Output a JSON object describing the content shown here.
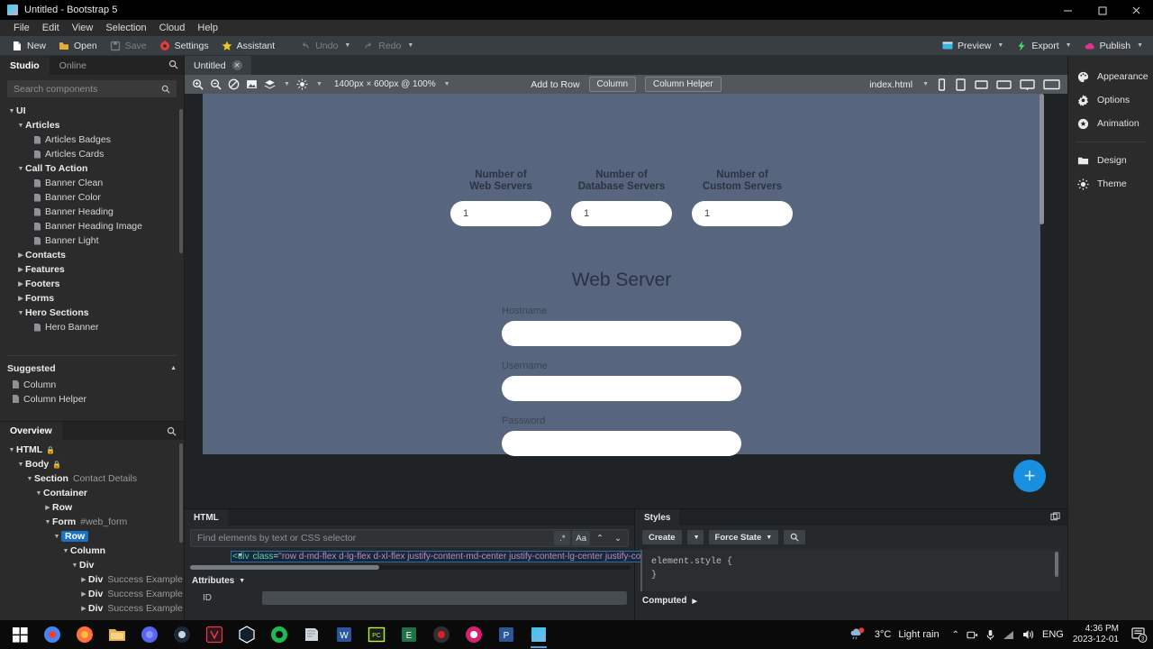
{
  "window": {
    "title": "Untitled - Bootstrap 5",
    "app_icon": "bootstrap-studio-icon",
    "controls": {
      "minimize": "minimize-icon",
      "maximize": "maximize-icon",
      "close": "close-icon"
    }
  },
  "menubar": {
    "items": [
      "File",
      "Edit",
      "View",
      "Selection",
      "Cloud",
      "Help"
    ]
  },
  "toolbar": {
    "left": [
      {
        "label": "New",
        "icon": "new-file-icon",
        "disabled": false
      },
      {
        "label": "Open",
        "icon": "open-folder-icon",
        "disabled": false
      },
      {
        "label": "Save",
        "icon": "save-disk-icon",
        "disabled": true
      },
      {
        "label": "Settings",
        "icon": "settings-gear-icon",
        "disabled": false
      },
      {
        "label": "Assistant",
        "icon": "assistant-star-icon",
        "disabled": false
      },
      {
        "label": "Undo",
        "icon": "undo-arrow-icon",
        "disabled": true,
        "caret": true
      },
      {
        "label": "Redo",
        "icon": "redo-arrow-icon",
        "disabled": true,
        "caret": true
      }
    ],
    "right": [
      {
        "label": "Preview",
        "icon": "preview-monitor-icon",
        "caret": true
      },
      {
        "label": "Export",
        "icon": "export-bolt-icon",
        "caret": true
      },
      {
        "label": "Publish",
        "icon": "publish-cloud-icon",
        "caret": true
      }
    ]
  },
  "left_panel": {
    "tabs": [
      {
        "label": "Studio",
        "active": true
      },
      {
        "label": "Online",
        "active": false
      }
    ],
    "search_icon": "search-icon",
    "search": {
      "placeholder": "Search components",
      "value": "",
      "icon": "search-icon"
    },
    "tree": [
      {
        "label": "UI",
        "depth": 0,
        "type": "group",
        "expanded": true
      },
      {
        "label": "Articles",
        "depth": 1,
        "type": "group",
        "expanded": true
      },
      {
        "label": "Articles Badges",
        "depth": 2,
        "type": "item"
      },
      {
        "label": "Articles Cards",
        "depth": 2,
        "type": "item"
      },
      {
        "label": "Call To Action",
        "depth": 1,
        "type": "group",
        "expanded": true
      },
      {
        "label": "Banner Clean",
        "depth": 2,
        "type": "item"
      },
      {
        "label": "Banner Color",
        "depth": 2,
        "type": "item"
      },
      {
        "label": "Banner Heading",
        "depth": 2,
        "type": "item"
      },
      {
        "label": "Banner Heading Image",
        "depth": 2,
        "type": "item"
      },
      {
        "label": "Banner Light",
        "depth": 2,
        "type": "item"
      },
      {
        "label": "Contacts",
        "depth": 1,
        "type": "group",
        "expanded": false
      },
      {
        "label": "Features",
        "depth": 1,
        "type": "group",
        "expanded": false
      },
      {
        "label": "Footers",
        "depth": 1,
        "type": "group",
        "expanded": false
      },
      {
        "label": "Forms",
        "depth": 1,
        "type": "group",
        "expanded": false
      },
      {
        "label": "Hero Sections",
        "depth": 1,
        "type": "group",
        "expanded": true
      },
      {
        "label": "Hero Banner",
        "depth": 2,
        "type": "item"
      }
    ],
    "suggested": {
      "title": "Suggested",
      "collapse_icon": "chevron-up-icon",
      "items": [
        {
          "label": "Column"
        },
        {
          "label": "Column Helper"
        }
      ]
    },
    "overview": {
      "tab_label": "Overview",
      "search_icon": "search-icon",
      "nodes": [
        {
          "tag": "HTML",
          "meta": "",
          "depth": 0,
          "expanded": true,
          "locked": true
        },
        {
          "tag": "Body",
          "meta": "",
          "depth": 1,
          "expanded": true,
          "locked": true
        },
        {
          "tag": "Section",
          "meta": "Contact Details",
          "depth": 2,
          "expanded": true
        },
        {
          "tag": "Container",
          "meta": "",
          "depth": 3,
          "expanded": true
        },
        {
          "tag": "Row",
          "meta": "",
          "depth": 4,
          "expanded": false
        },
        {
          "tag": "Form",
          "meta": "#web_form",
          "depth": 4,
          "expanded": true
        },
        {
          "tag": "Row",
          "meta": "",
          "depth": 5,
          "expanded": true,
          "selected": true
        },
        {
          "tag": "Column",
          "meta": "",
          "depth": 6,
          "expanded": true
        },
        {
          "tag": "Div",
          "meta": "",
          "depth": 7,
          "expanded": true
        },
        {
          "tag": "Div",
          "meta": "Success Example",
          "depth": 8,
          "expanded": false
        },
        {
          "tag": "Div",
          "meta": "Success Example",
          "depth": 8,
          "expanded": false
        },
        {
          "tag": "Div",
          "meta": "Success Example",
          "depth": 8,
          "expanded": false
        }
      ]
    }
  },
  "center": {
    "document_tabs": [
      {
        "label": "Untitled",
        "close_icon": "close-icon",
        "active": true
      }
    ],
    "canvas_toolbar": {
      "icons": [
        "zoom-in-icon",
        "zoom-out-icon",
        "no-preview-icon",
        "image-icon",
        "layers-icon",
        "brightness-icon"
      ],
      "size_label": "1400px × 600px @ 100%",
      "add_to_row_label": "Add to Row",
      "buttons": [
        "Column",
        "Column Helper"
      ],
      "file_select": "index.html",
      "devices": [
        "phone-icon",
        "tablet-icon",
        "tablet-landscape-icon",
        "laptop-icon",
        "desktop-icon",
        "wide-desktop-icon"
      ]
    },
    "page": {
      "counters": [
        {
          "label_line1": "Number of",
          "label_line2": "Web Servers",
          "value": "1"
        },
        {
          "label_line1": "Number of",
          "label_line2": "Database Servers",
          "value": "1"
        },
        {
          "label_line1": "Number of",
          "label_line2": "Custom Servers",
          "value": "1"
        }
      ],
      "section_title": "Web Server",
      "fields": [
        {
          "label": "Hostname",
          "value": ""
        },
        {
          "label": "Username",
          "value": ""
        },
        {
          "label": "Password",
          "value": ""
        }
      ],
      "background_color": "#57667e",
      "add_button_icon": "plus-icon"
    }
  },
  "dock": {
    "html_panel": {
      "tab_label": "HTML",
      "finder": {
        "placeholder": "Find elements by text or CSS selector",
        "value": "",
        "buttons": [
          "regex-icon",
          "Aa",
          "chevron-up-icon",
          "chevron-down-icon"
        ]
      },
      "code_line": {
        "caret_icon": "chevron-down-icon",
        "tag_open": "<div",
        "attr_name": "class",
        "equals": "=",
        "attr_value": "\"row d-md-flex d-lg-flex d-xl-flex justify-content-md-center justify-content-lg-center justify-content-x"
      },
      "attributes": {
        "title": "Attributes",
        "toggle_icon": "chevron-down-icon",
        "rows": [
          {
            "key": "ID",
            "value": ""
          }
        ]
      }
    },
    "styles_panel": {
      "tab_label": "Styles",
      "corner_icon": "detach-panel-icon",
      "create_label": "Create",
      "create_caret_icon": "chevron-down-icon",
      "force_state_label": "Force State",
      "force_state_caret_icon": "chevron-down-icon",
      "search_icon": "search-icon",
      "code": "element.style {\n}",
      "computed_label": "Computed",
      "computed_icon": "chevron-right-icon"
    }
  },
  "right_panel": {
    "groups": [
      {
        "items": [
          {
            "label": "Appearance",
            "icon": "palette-icon"
          },
          {
            "label": "Options",
            "icon": "gear-icon"
          },
          {
            "label": "Animation",
            "icon": "animation-icon"
          }
        ]
      },
      {
        "items": [
          {
            "label": "Design",
            "icon": "folder-icon"
          },
          {
            "label": "Theme",
            "icon": "theme-sun-icon"
          }
        ]
      }
    ]
  },
  "taskbar": {
    "start_icon": "windows-start-icon",
    "apps": [
      "chrome-icon",
      "firefox-icon",
      "file-explorer-icon",
      "discord-icon",
      "steam-icon",
      "vivaldi-icon",
      "unity-icon",
      "spotify-icon",
      "notes-icon",
      "word-icon",
      "pc-icon",
      "excel-icon",
      "obs-icon",
      "krita-icon",
      "powershell-icon",
      "bootstrap-studio-icon"
    ],
    "tray": {
      "weather_icon": "weather-rain-icon",
      "weather_temp": "3°C",
      "weather_desc": "Light rain",
      "overflow_icon": "chevron-up-icon",
      "icons": [
        "camera-icon",
        "microphone-icon",
        "network-icon",
        "volume-icon"
      ],
      "language": "ENG",
      "time": "4:36 PM",
      "date": "2023-12-01",
      "notification_icon": "notifications-icon",
      "notification_count": "3"
    }
  },
  "colors": {
    "accent_blue": "#1a8fe0",
    "selection_blue": "#1b72c4",
    "canvas_bg": "#57667e",
    "panel_bg": "#2b2b2b",
    "toolbar_bg": "#383e42"
  }
}
